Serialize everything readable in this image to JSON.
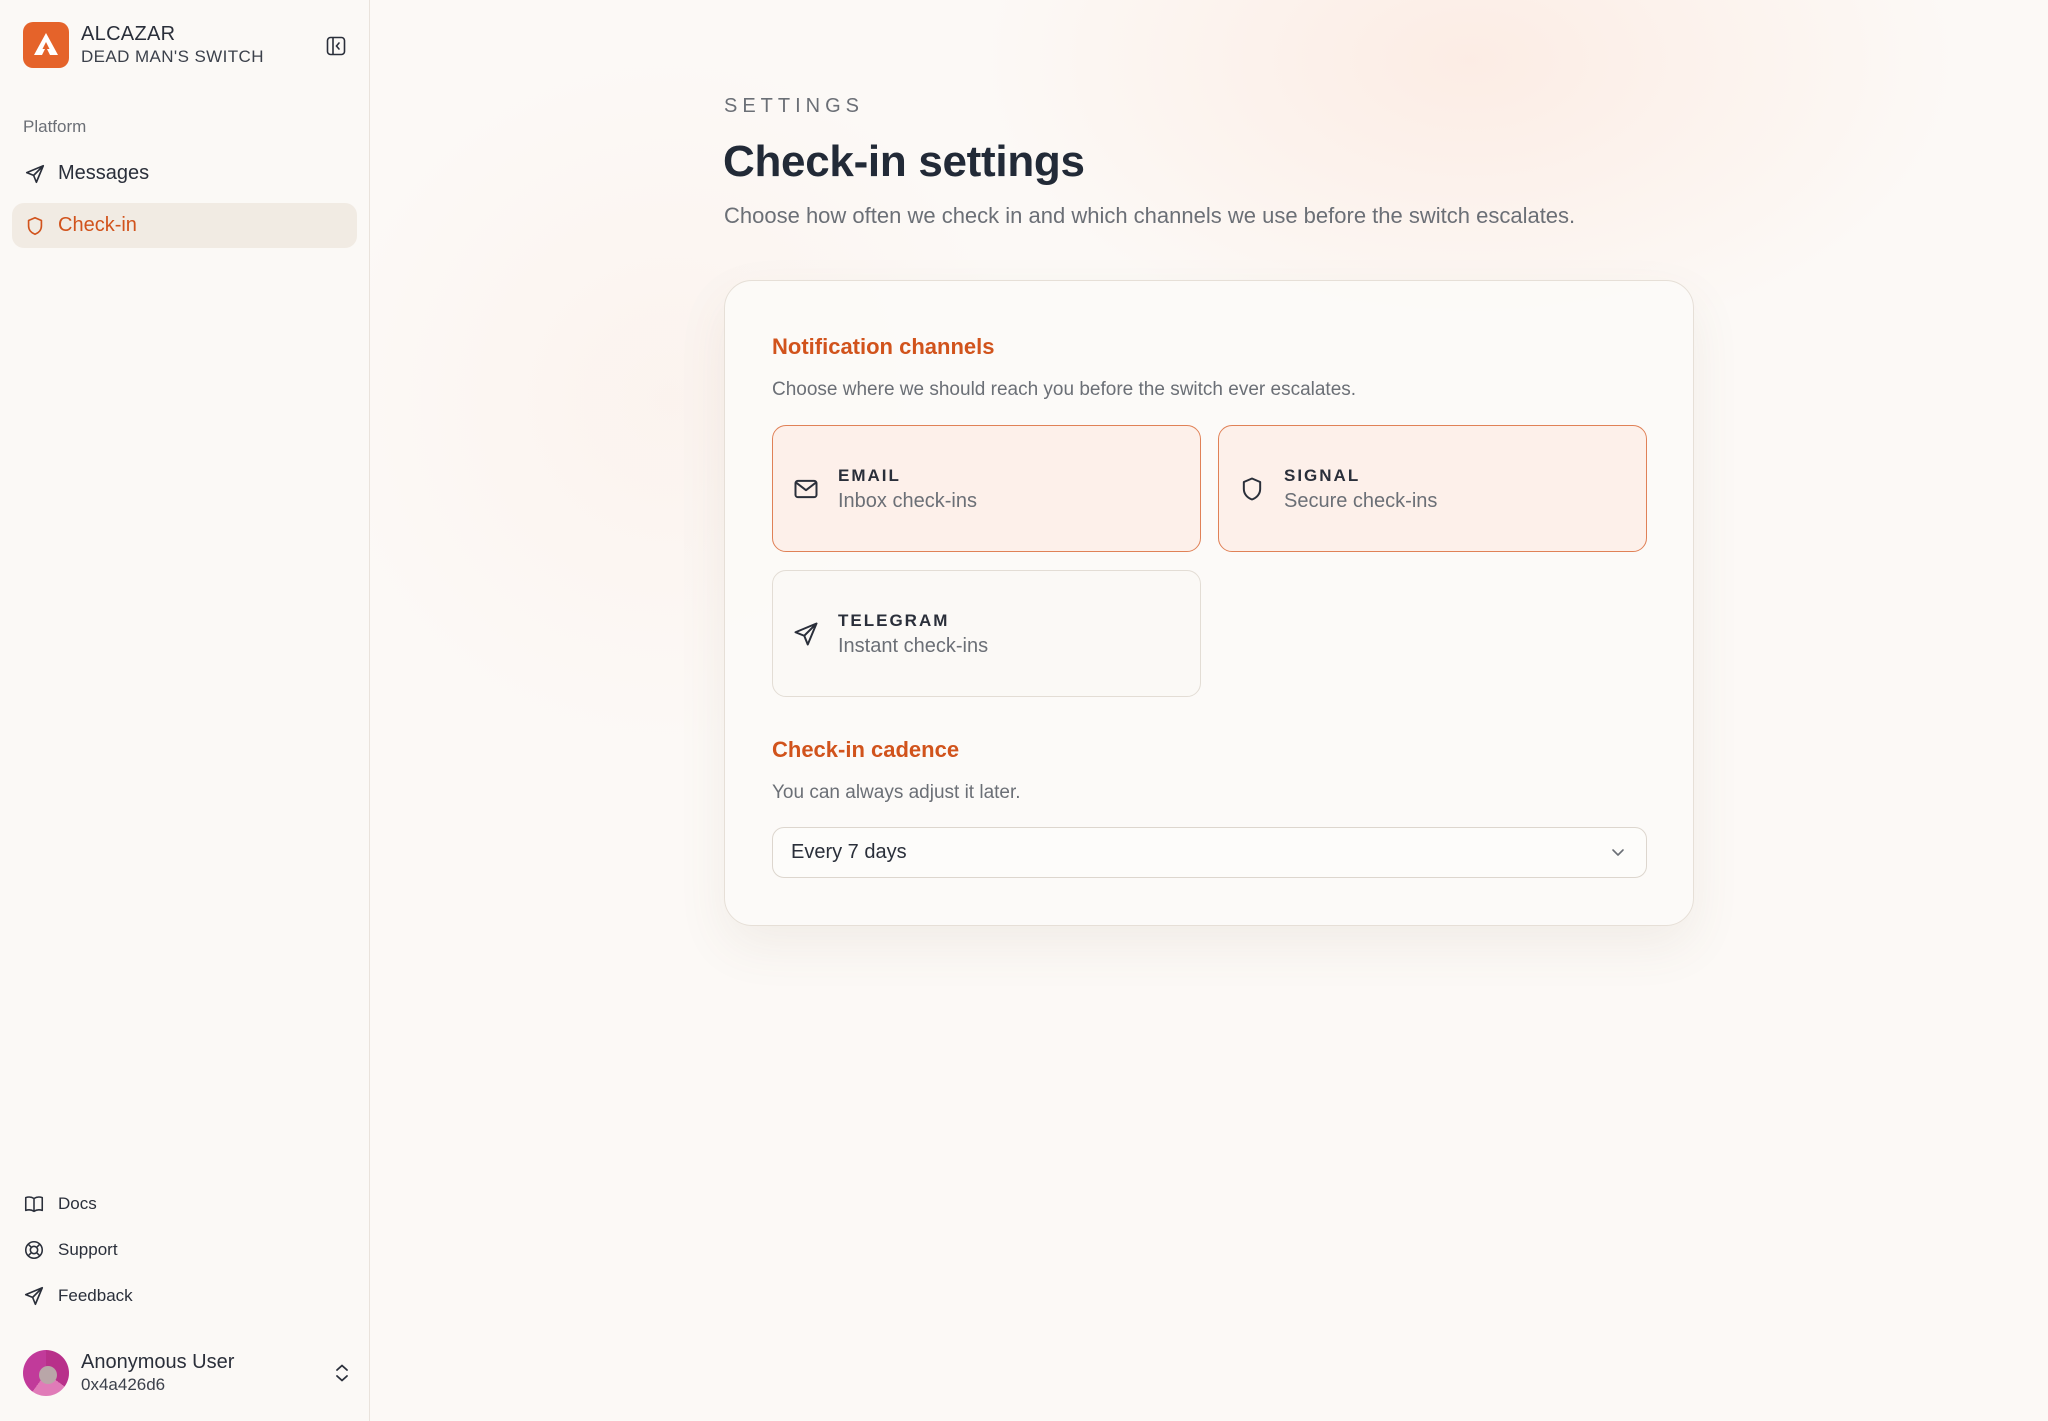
{
  "brand": {
    "name": "ALCAZAR",
    "subtitle": "DEAD MAN'S SWITCH"
  },
  "sidebar": {
    "section_label": "Platform",
    "items": [
      {
        "label": "Messages",
        "icon": "send-icon",
        "active": false
      },
      {
        "label": "Check-in",
        "icon": "shield-icon",
        "active": true
      }
    ],
    "footer_links": [
      {
        "label": "Docs",
        "icon": "book-icon"
      },
      {
        "label": "Support",
        "icon": "lifebuoy-icon"
      },
      {
        "label": "Feedback",
        "icon": "send-icon"
      }
    ],
    "user": {
      "name": "Anonymous User",
      "address": "0x4a426d6"
    }
  },
  "page": {
    "eyebrow": "SETTINGS",
    "title": "Check-in settings",
    "subtitle": "Choose how often we check in and which channels we use before the switch escalates."
  },
  "notifications": {
    "heading": "Notification channels",
    "description": "Choose where we should reach you before the switch ever escalates.",
    "channels": [
      {
        "title": "EMAIL",
        "subtitle": "Inbox check-ins",
        "icon": "mail-icon",
        "selected": true
      },
      {
        "title": "SIGNAL",
        "subtitle": "Secure check-ins",
        "icon": "shield-icon",
        "selected": true
      },
      {
        "title": "TELEGRAM",
        "subtitle": "Instant check-ins",
        "icon": "send-icon",
        "selected": false
      }
    ]
  },
  "cadence": {
    "heading": "Check-in cadence",
    "description": "You can always adjust it later.",
    "selected": "Every 7 days"
  },
  "colors": {
    "accent": "#d1531c",
    "brand": "#e5632a",
    "selected_border": "#e08157",
    "selected_bg": "#fdf0ea"
  }
}
